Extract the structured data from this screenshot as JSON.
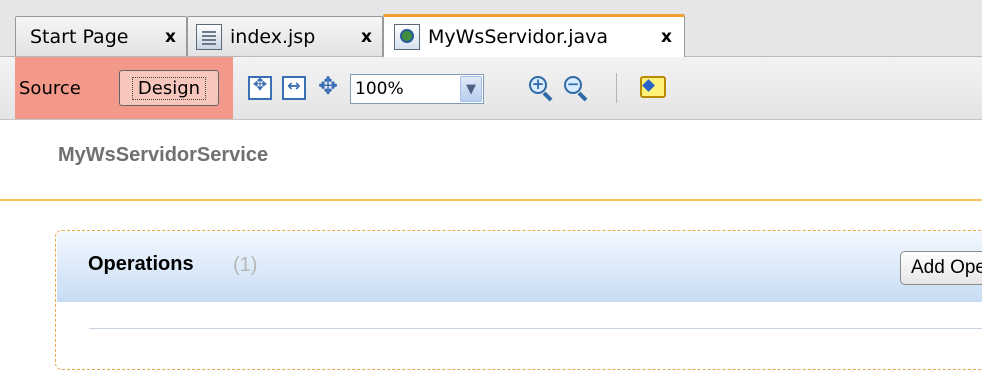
{
  "tabs": [
    {
      "label": "Start Page",
      "icon": null,
      "close": "x",
      "active": false
    },
    {
      "label": "index.jsp",
      "icon": "jsp-file-icon",
      "close": "x",
      "active": false
    },
    {
      "label": "MyWsServidor.java",
      "icon": "java-file-icon",
      "close": "x",
      "active": true
    }
  ],
  "toolbar": {
    "source_label": "Source",
    "design_label": "Design",
    "zoom_value": "100%",
    "highlight_color": "#f3998a",
    "icons": [
      "fit-diagram-icon",
      "fit-width-icon",
      "fit-height-icon",
      "zoom-in-icon",
      "zoom-out-icon",
      "comment-icon"
    ]
  },
  "main": {
    "service_title": "MyWsServidorService",
    "operations": {
      "title": "Operations",
      "count": "(1)",
      "add_button_label": "Add Operation..."
    }
  }
}
